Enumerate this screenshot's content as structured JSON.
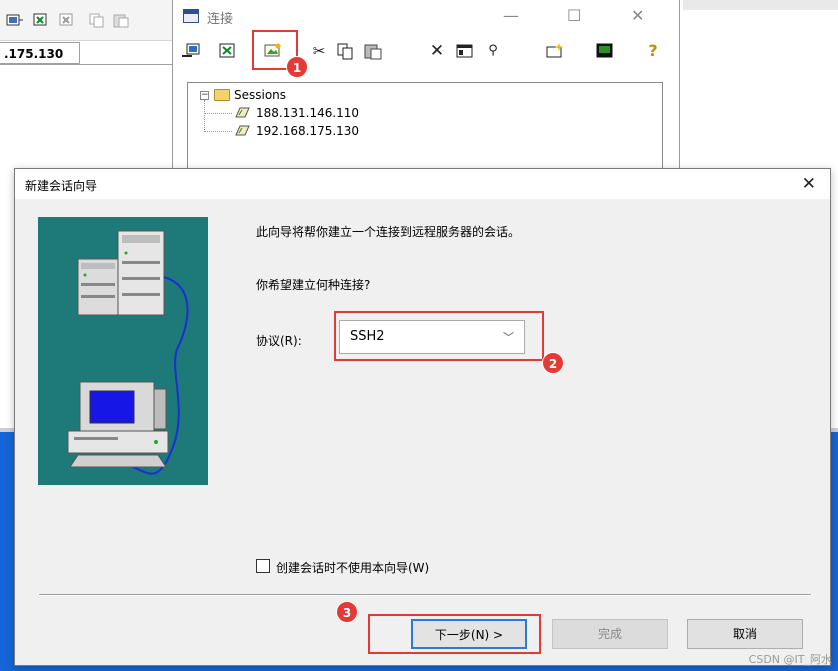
{
  "background": {
    "tab_label": ".175.130"
  },
  "connect_window": {
    "title": "连接",
    "minimize_glyph": "—",
    "maximize_glyph": "☐",
    "close_glyph": "✕",
    "toolbar_icons": [
      "connect-icon",
      "quick-connect-icon",
      "new-session-icon",
      "cut-icon",
      "copy-icon",
      "paste-icon",
      "delete-icon",
      "properties-icon",
      "find-icon",
      "new-folder-icon",
      "terminal-icon",
      "help-icon"
    ],
    "tree": {
      "root_label": "Sessions",
      "sessions": [
        "188.131.146.110",
        "192.168.175.130"
      ]
    }
  },
  "wizard": {
    "title": "新建会话向导",
    "close_glyph": "✕",
    "intro_text": "此向导将帮你建立一个连接到远程服务器的会话。",
    "question_text": "你希望建立何种连接?",
    "protocol_label": "协议(R):",
    "protocol_value": "SSH2",
    "chevron_glyph": "﹀",
    "checkbox_label": "创建会话时不使用本向导(W)",
    "buttons": {
      "next": "下一步(N) >",
      "finish": "完成",
      "cancel": "取消"
    }
  },
  "annotations": {
    "badge1": "1",
    "badge2": "2",
    "badge3": "3",
    "color": "#e53935"
  },
  "watermark": "CSDN @IT_阿水"
}
